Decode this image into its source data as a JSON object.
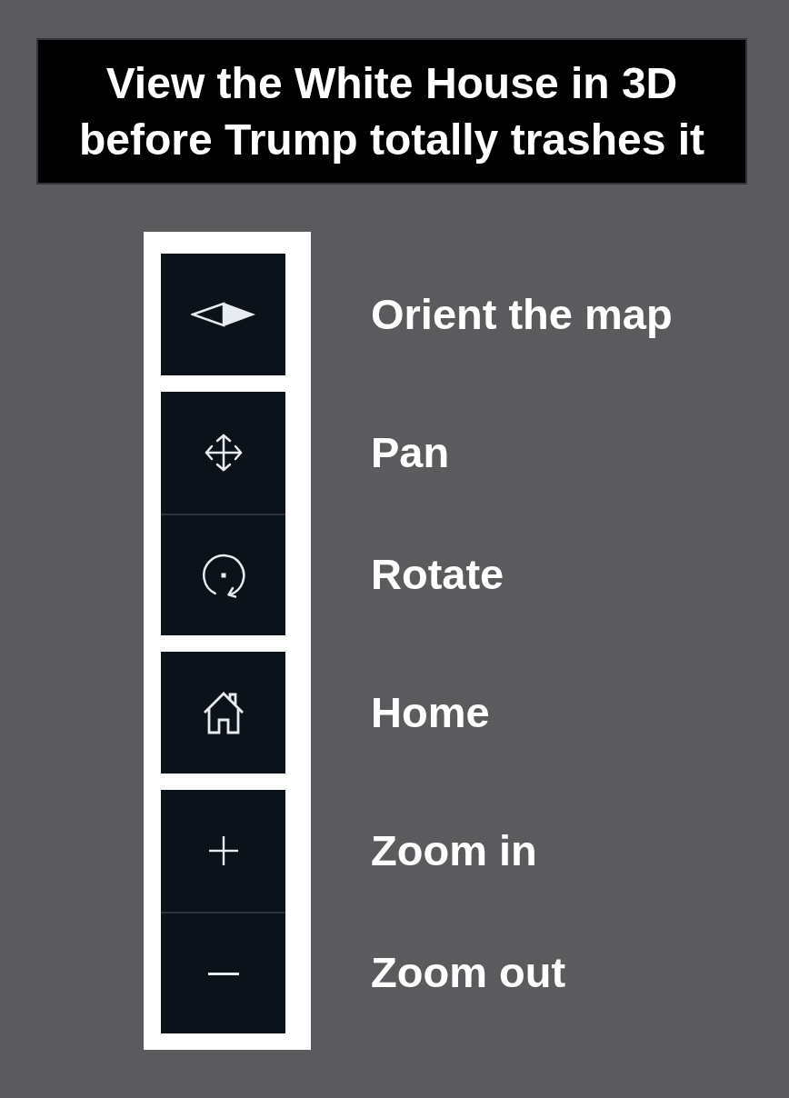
{
  "banner": {
    "title": "View the White House in 3D before Trump totally trashes it"
  },
  "control_groups": [
    {
      "controls": [
        {
          "kind": "compass",
          "label": "Orient the map"
        }
      ]
    },
    {
      "controls": [
        {
          "kind": "pan",
          "label": "Pan"
        },
        {
          "kind": "rotate",
          "label": "Rotate"
        }
      ]
    },
    {
      "controls": [
        {
          "kind": "home",
          "label": "Home"
        }
      ]
    },
    {
      "controls": [
        {
          "kind": "zoom_in",
          "label": "Zoom in"
        },
        {
          "kind": "zoom_out",
          "label": "Zoom out"
        }
      ]
    }
  ]
}
